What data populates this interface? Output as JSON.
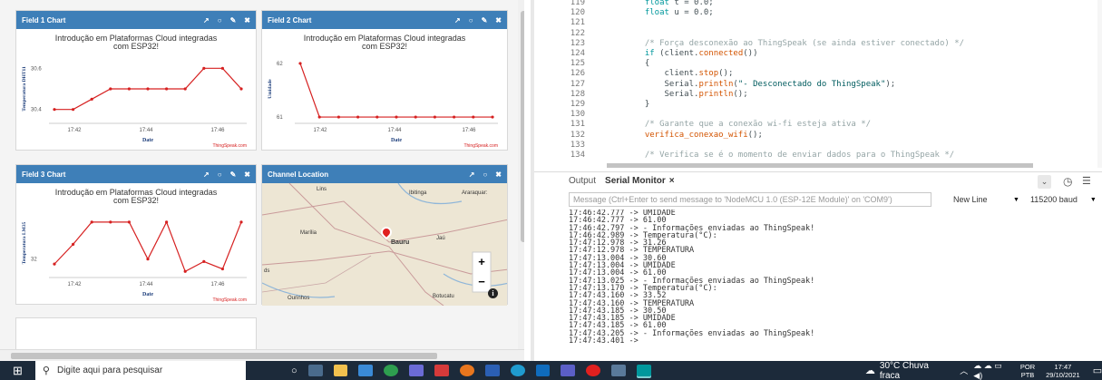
{
  "widgets": {
    "f1": {
      "title": "Field 1 Chart",
      "chart_title": "Introdução em Plataformas Cloud integradas com ESP32!",
      "ylabel": "Temperatura DHT11",
      "xlabel": "Date",
      "credit": "ThingSpeak.com",
      "yticks": [
        "30.6",
        "30.4"
      ],
      "xticks": [
        "17:42",
        "17:44",
        "17:46"
      ]
    },
    "f2": {
      "title": "Field 2 Chart",
      "chart_title": "Introdução em Plataformas Cloud integradas com ESP32!",
      "ylabel": "Umidade",
      "xlabel": "Date",
      "credit": "ThingSpeak.com",
      "yticks": [
        "62",
        "61"
      ],
      "xticks": [
        "17:42",
        "17:44",
        "17:46"
      ]
    },
    "f3": {
      "title": "Field 3 Chart",
      "chart_title": "Introdução em Plataformas Cloud integradas com ESP32!",
      "ylabel": "Temperatura LM35",
      "xlabel": "Date",
      "credit": "ThingSpeak.com",
      "yticks": [
        "32"
      ],
      "xticks": [
        "17:42",
        "17:44",
        "17:46"
      ]
    },
    "map": {
      "title": "Channel Location",
      "labels": [
        "Lins",
        "Ibitinga",
        "Araraquar:",
        "Marília",
        "Bauru",
        "Jaú",
        "Botucatu",
        "Ourinhos",
        "ds"
      ],
      "zoom_in": "+",
      "zoom_out": "−",
      "info": "i"
    }
  },
  "chart_data": [
    {
      "type": "line",
      "title": "Introdução em Plataformas Cloud integradas com ESP32!",
      "xlabel": "Date",
      "ylabel": "Temperatura DHT11",
      "ylim": [
        30.35,
        30.65
      ],
      "series": [
        {
          "values": [
            30.4,
            30.4,
            30.45,
            30.5,
            30.5,
            30.5,
            30.5,
            30.5,
            30.6,
            30.6,
            30.5
          ]
        }
      ],
      "color": "#d62020"
    },
    {
      "type": "line",
      "title": "Introdução em Plataformas Cloud integradas com ESP32!",
      "xlabel": "Date",
      "ylabel": "Umidade",
      "ylim": [
        60.95,
        62.1
      ],
      "series": [
        {
          "values": [
            62,
            61,
            61,
            61,
            61,
            61,
            61,
            61,
            61,
            61,
            61
          ]
        }
      ],
      "color": "#d62020"
    },
    {
      "type": "line",
      "title": "Introdução em Plataformas Cloud integradas com ESP32!",
      "xlabel": "Date",
      "ylabel": "Temperatura LM35",
      "ylim": [
        31.4,
        33.9
      ],
      "series": [
        {
          "values": [
            31.8,
            32.6,
            33.5,
            33.5,
            33.5,
            32,
            33.5,
            31.5,
            31.9,
            31.6,
            33.5
          ]
        }
      ],
      "color": "#d62020"
    }
  ],
  "code": {
    "lines": [
      {
        "n": "119",
        "t": "  float t = 0.0;"
      },
      {
        "n": "120",
        "t": "  float u = 0.0;"
      },
      {
        "n": "121",
        "t": ""
      },
      {
        "n": "122",
        "t": ""
      },
      {
        "n": "123",
        "t": "  /* Força desconexão ao ThingSpeak (se ainda estiver conectado) */"
      },
      {
        "n": "124",
        "t": "  if (client.connected())"
      },
      {
        "n": "125",
        "t": "  {"
      },
      {
        "n": "126",
        "t": "      client.stop();"
      },
      {
        "n": "127",
        "t": "      Serial.println(\"- Desconectado do ThingSpeak\");"
      },
      {
        "n": "128",
        "t": "      Serial.println();"
      },
      {
        "n": "129",
        "t": "  }"
      },
      {
        "n": "130",
        "t": ""
      },
      {
        "n": "131",
        "t": "  /* Garante que a conexão wi-fi esteja ativa */"
      },
      {
        "n": "132",
        "t": "  verifica_conexao_wifi();"
      },
      {
        "n": "133",
        "t": ""
      },
      {
        "n": "134",
        "t": "  /* Verifica se é o momento de enviar dados para o ThingSpeak */"
      }
    ]
  },
  "panel": {
    "output_tab": "Output",
    "serial_tab": "Serial Monitor",
    "close": "×"
  },
  "serial": {
    "placeholder": "Message (Ctrl+Enter to send message to 'NodeMCU 1.0 (ESP-12E Module)' on 'COM9')",
    "line_ending": "New Line",
    "baud": "115200 baud",
    "lines": [
      "17:46:42.777 -> UMIDADE",
      "17:46:42.777 -> 61.00",
      "17:46:42.797 -> - Informações enviadas ao ThingSpeak!",
      "17:46:42.989 -> Temperatura(°C):",
      "17:47:12.978 -> 31.26",
      "17:47:12.978 -> TEMPERATURA",
      "17:47:13.004 -> 30.60",
      "17:47:13.004 -> UMIDADE",
      "17:47:13.004 -> 61.00",
      "17:47:13.025 -> - Informações enviadas ao ThingSpeak!",
      "17:47:13.170 -> Temperatura(°C):",
      "17:47:43.160 -> 33.52",
      "17:47:43.160 -> TEMPERATURA",
      "17:47:43.185 -> 30.50",
      "17:47:43.185 -> UMIDADE",
      "17:47:43.185 -> 61.00",
      "17:47:43.205 -> - Informações enviadas ao ThingSpeak!",
      "17:47:43.401 -> "
    ]
  },
  "taskbar": {
    "search": "Digite aqui para pesquisar",
    "weather": "30°C  Chuva fraca",
    "lang1": "POR",
    "lang2": "PTB",
    "time": "17:47",
    "date": "29/10/2021"
  }
}
